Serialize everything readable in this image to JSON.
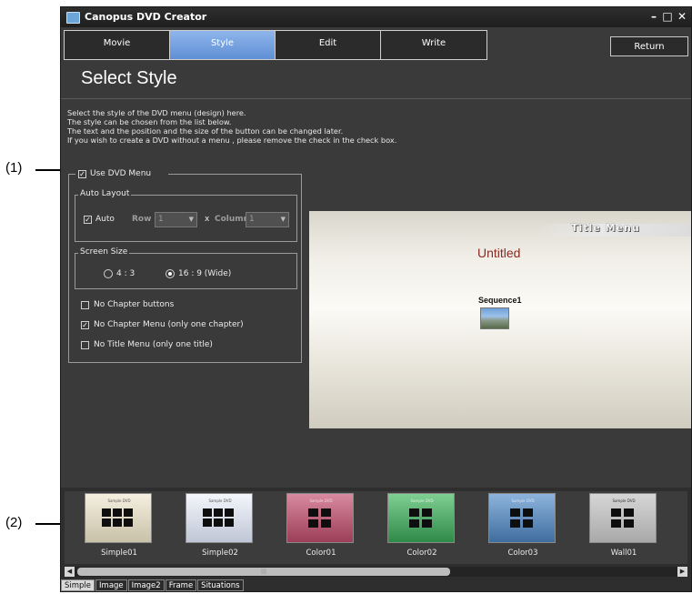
{
  "callouts": [
    "(1)",
    "(2)"
  ],
  "window": {
    "title": "Canopus DVD Creator",
    "controls": {
      "minimize": "–",
      "maximize": "□",
      "close": "✕"
    }
  },
  "tabs": [
    "Movie",
    "Style",
    "Edit",
    "Write"
  ],
  "active_tab": "Style",
  "return_label": "Return",
  "page_title": "Select Style",
  "description": [
    "Select the style of the DVD menu (design) here.",
    "The style can be chosen from the list below.",
    "The text and the position and the size of the button can be changed later.",
    "If you wish to create a DVD without a menu , please remove the check in the check box."
  ],
  "options": {
    "use_dvd_menu": {
      "label": "Use DVD Menu",
      "checked": true
    },
    "auto_layout": {
      "group_label": "Auto Layout",
      "auto": {
        "label": "Auto",
        "checked": true
      },
      "row_label": "Row",
      "row_value": "1",
      "x_label": "x",
      "column_label": "Column",
      "column_value": "1"
    },
    "screen_size": {
      "group_label": "Screen Size",
      "ratio_43": "4 : 3",
      "ratio_169": "16 : 9 (Wide)",
      "selected": "16 : 9 (Wide)"
    },
    "no_chapter_buttons": {
      "label": "No Chapter buttons",
      "checked": false
    },
    "no_chapter_menu": {
      "label": "No Chapter Menu (only one chapter)",
      "checked": true
    },
    "no_title_menu": {
      "label": "No Title Menu (only one title)",
      "checked": false
    }
  },
  "preview": {
    "title_menu": "Title Menu",
    "heading": "Untitled",
    "item": "Sequence1"
  },
  "styles": [
    {
      "name": "Simple01",
      "color": "#e4ddc8"
    },
    {
      "name": "Simple02",
      "color": "#dfe3ee"
    },
    {
      "name": "Color01",
      "color": "#b8566e"
    },
    {
      "name": "Color02",
      "color": "#3c9a55"
    },
    {
      "name": "Color03",
      "color": "#4a78a8"
    },
    {
      "name": "Wall01",
      "color": "#bfbfbf"
    }
  ],
  "bottom_tabs": [
    "Simple",
    "Image",
    "Image2",
    "Frame",
    "Situations"
  ],
  "active_bottom_tab": "Simple"
}
